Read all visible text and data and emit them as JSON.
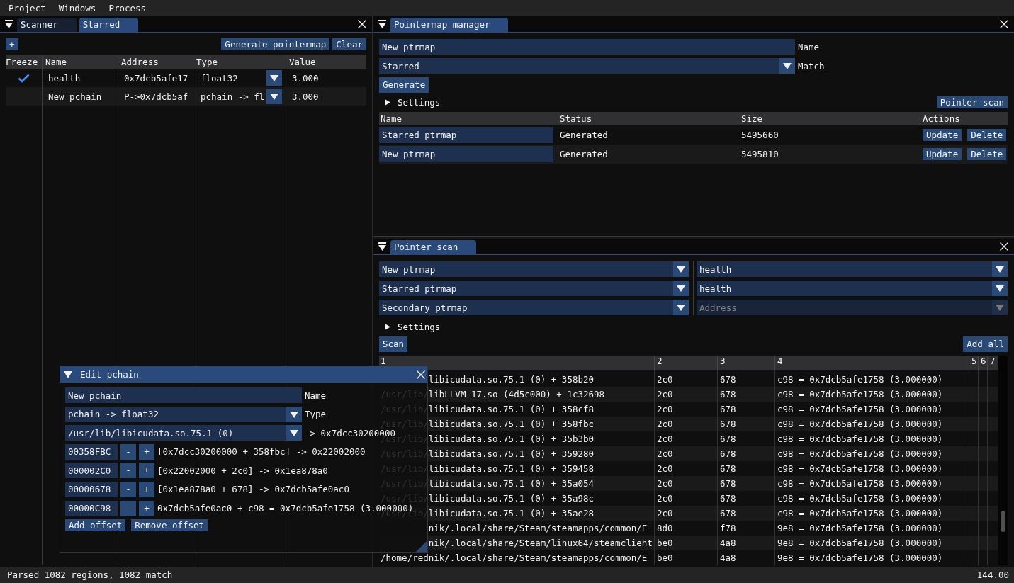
{
  "menu_bar": [
    "Project",
    "Windows",
    "Process"
  ],
  "starred_panel": {
    "tabs": [
      {
        "label": "Scanner",
        "selected": false
      },
      {
        "label": "Starred",
        "selected": true
      }
    ],
    "add_button": "+",
    "buttons": [
      "Generate pointermap",
      "Clear"
    ],
    "table": {
      "columns": [
        "Freeze",
        "Name",
        "Address",
        "Type",
        "Value"
      ],
      "rows": [
        {
          "freeze": true,
          "name": "health",
          "address": "0x7dcb5afe17",
          "type": "float32",
          "value": "3.000"
        },
        {
          "freeze": false,
          "name": "New pchain",
          "address": "P->0x7dcb5af",
          "type": "pchain -> fl",
          "value": "3.000"
        }
      ]
    }
  },
  "pointermap_manager": {
    "tabs": [
      {
        "label": "Pointermap manager",
        "selected": true
      }
    ],
    "name_field": {
      "value": "New ptrmap",
      "label": "Name"
    },
    "match_dropdown": {
      "value": "Starred",
      "label": "Match"
    },
    "generate_button": "Generate",
    "settings": {
      "label": "Settings",
      "expanded": false
    },
    "pointer_scan_button": "Pointer scan",
    "table": {
      "columns": [
        "Name",
        "Status",
        "Size",
        "Actions"
      ],
      "rows": [
        {
          "name": "Starred ptrmap",
          "status": "Generated",
          "size": "5495660",
          "actions": [
            "Update",
            "Delete"
          ]
        },
        {
          "name": "New ptrmap",
          "status": "Generated",
          "size": "5495810",
          "actions": [
            "Update",
            "Delete"
          ]
        }
      ]
    }
  },
  "pointer_scan": {
    "tabs": [
      {
        "label": "Pointer scan",
        "selected": true
      }
    ],
    "ptrmap_dropdowns": [
      {
        "value": "New ptrmap"
      },
      {
        "value": "Starred ptrmap"
      },
      {
        "value": "Secondary ptrmap"
      }
    ],
    "target_dropdowns": [
      {
        "value": "health",
        "disabled": false
      },
      {
        "value": "health",
        "disabled": false
      },
      {
        "placeholder": "Address",
        "disabled": true
      }
    ],
    "settings": {
      "label": "Settings",
      "expanded": false
    },
    "scan_button": "Scan",
    "add_all_button": "Add all",
    "table": {
      "columns": [
        "1",
        "2",
        "3",
        "4",
        "5",
        "6",
        "7"
      ],
      "rows": [
        {
          "under_window": true,
          "cells": [
            "libicudata.so.75.1 (0) + 358b20",
            "2c0",
            "678",
            "c98 = 0x7dcb5afe1758 (3.000000)"
          ]
        },
        {
          "under_window": false,
          "cells": [
            "/usr/lib/libLLVM-17.so (4d5c000) + 1c32698",
            "2c0",
            "678",
            "c98 = 0x7dcb5afe1758 (3.000000)"
          ]
        },
        {
          "under_window": false,
          "cells": [
            "/usr/lib/libicudata.so.75.1 (0) + 358cf8",
            "2c0",
            "678",
            "c98 = 0x7dcb5afe1758 (3.000000)"
          ]
        },
        {
          "under_window": false,
          "cells": [
            "/usr/lib/libicudata.so.75.1 (0) + 358fbc",
            "2c0",
            "678",
            "c98 = 0x7dcb5afe1758 (3.000000)"
          ]
        },
        {
          "under_window": false,
          "cells": [
            "/usr/lib/libicudata.so.75.1 (0) + 35b3b0",
            "2c0",
            "678",
            "c98 = 0x7dcb5afe1758 (3.000000)"
          ]
        },
        {
          "under_window": false,
          "cells": [
            "/usr/lib/libicudata.so.75.1 (0) + 359280",
            "2c0",
            "678",
            "c98 = 0x7dcb5afe1758 (3.000000)"
          ]
        },
        {
          "under_window": false,
          "cells": [
            "/usr/lib/libicudata.so.75.1 (0) + 359458",
            "2c0",
            "678",
            "c98 = 0x7dcb5afe1758 (3.000000)"
          ]
        },
        {
          "under_window": false,
          "cells": [
            "/usr/lib/libicudata.so.75.1 (0) + 35a054",
            "2c0",
            "678",
            "c98 = 0x7dcb5afe1758 (3.000000)"
          ]
        },
        {
          "under_window": false,
          "cells": [
            "/usr/lib/libicudata.so.75.1 (0) + 35a98c",
            "2c0",
            "678",
            "c98 = 0x7dcb5afe1758 (3.000000)"
          ]
        },
        {
          "under_window": false,
          "cells": [
            "/usr/lib/libicudata.so.75.1 (0) + 35ae28",
            "2c0",
            "678",
            "c98 = 0x7dcb5afe1758 (3.000000)"
          ]
        },
        {
          "under_window": true,
          "cells": [
            "nik/.local/share/Steam/steamapps/common/E",
            "8d0",
            "f78",
            "9e8 = 0x7dcb5afe1758 (3.000000)"
          ]
        },
        {
          "under_window": true,
          "cells": [
            "nik/.local/share/Steam/linux64/steamclient",
            "be0",
            "4a8",
            "9e8 = 0x7dcb5afe1758 (3.000000)"
          ]
        },
        {
          "under_window": false,
          "cells": [
            "/home/rednik/.local/share/Steam/steamapps/common/E",
            "be0",
            "4a8",
            "9e8 = 0x7dcb5afe1758 (3.000000)"
          ]
        }
      ]
    }
  },
  "edit_pchain": {
    "title": "Edit pchain",
    "name_field": {
      "value": "New pchain",
      "label": "Name"
    },
    "type_dropdown": {
      "value": "pchain -> float32",
      "label": "Type"
    },
    "module_dropdown": {
      "value": "/usr/lib/libicudata.so.75.1 (0)",
      "result": "-> 0x7dcc30200000"
    },
    "offsets": [
      {
        "value": "00358FBC",
        "buttons": [
          "-",
          "+"
        ],
        "result": "[0x7dcc30200000 + 358fbc] -> 0x22002000"
      },
      {
        "value": "000002C0",
        "buttons": [
          "-",
          "+"
        ],
        "result": "[0x22002000 + 2c0] -> 0x1ea878a0"
      },
      {
        "value": "00000678",
        "buttons": [
          "-",
          "+"
        ],
        "result": "[0x1ea878a0 + 678] -> 0x7dcb5afe0ac0"
      },
      {
        "value": "00000C98",
        "buttons": [
          "-",
          "+"
        ],
        "result": "0x7dcb5afe0ac0 + c98 = 0x7dcb5afe1758 (3.000000)"
      }
    ],
    "buttons": [
      "Add offset",
      "Remove offset"
    ]
  },
  "status_bar": {
    "message": "Parsed 1082 regions, 1082 match",
    "value": "144.00"
  }
}
